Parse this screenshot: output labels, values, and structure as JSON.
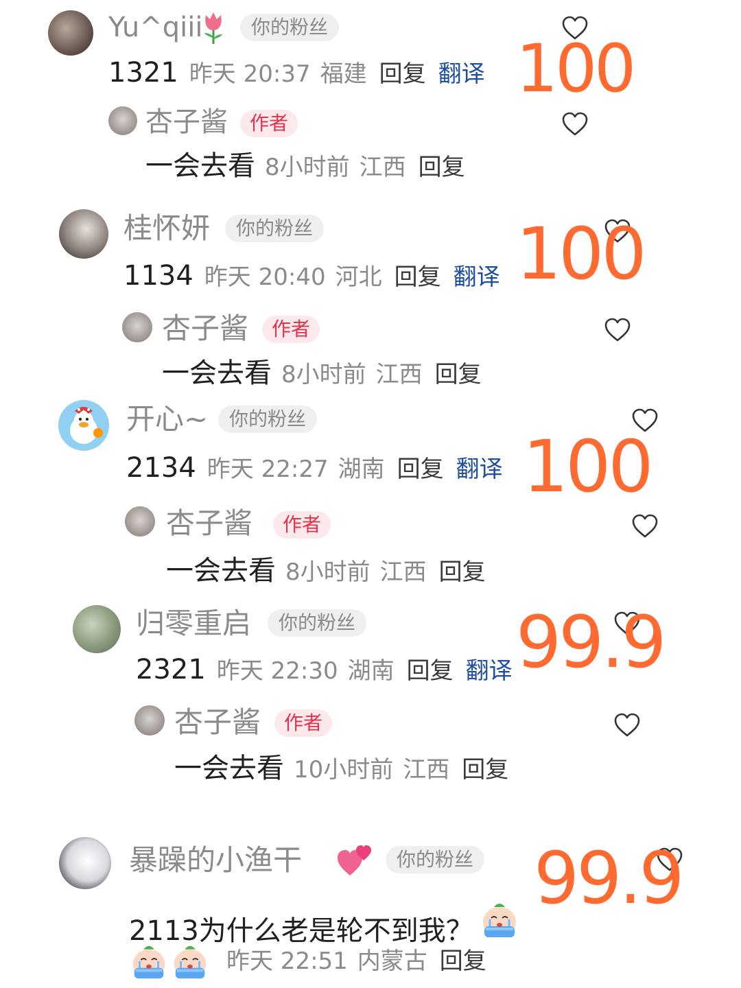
{
  "comments": [
    {
      "name": "Yu^qiii",
      "name_emoji": "tulip-icon",
      "badge": "你的粉丝",
      "content": "1321",
      "time": "昨天 20:37",
      "location": "福建",
      "reply": "回复",
      "translate": "翻译",
      "score": "100",
      "author_reply": {
        "name": "杏子酱",
        "badge": "作者",
        "content": "一会去看",
        "time": "8小时前",
        "location": "江西",
        "reply": "回复"
      }
    },
    {
      "name": "桂怀妍",
      "badge": "你的粉丝",
      "content": "1134",
      "time": "昨天 20:40",
      "location": "河北",
      "reply": "回复",
      "translate": "翻译",
      "score": "100",
      "author_reply": {
        "name": "杏子酱",
        "badge": "作者",
        "content": "一会去看",
        "time": "8小时前",
        "location": "江西",
        "reply": "回复"
      }
    },
    {
      "name": "开心~",
      "badge": "你的粉丝",
      "content": "2134",
      "time": "昨天 22:27",
      "location": "湖南",
      "reply": "回复",
      "translate": "翻译",
      "score": "100",
      "author_reply": {
        "name": "杏子酱",
        "badge": "作者",
        "content": "一会去看",
        "time": "8小时前",
        "location": "江西",
        "reply": "回复"
      }
    },
    {
      "name": "归零重启",
      "badge": "你的粉丝",
      "content": "2321",
      "time": "昨天 22:30",
      "location": "湖南",
      "reply": "回复",
      "translate": "翻译",
      "score": "99.9",
      "author_reply": {
        "name": "杏子酱",
        "badge": "作者",
        "content": "一会去看",
        "time": "10小时前",
        "location": "江西",
        "reply": "回复"
      }
    },
    {
      "name": "暴躁的小渔干",
      "name_emoji": "two-hearts-icon",
      "badge": "你的粉丝",
      "content": "2113为什么老是轮不到我？",
      "content_emoji": "crying-sticker-icon",
      "time": "昨天 22:51",
      "location": "内蒙古",
      "reply": "回复",
      "score": "99.9"
    }
  ],
  "colors": {
    "score": "#ff6a30",
    "author_badge_text": "#e3334b",
    "author_badge_bg": "#fde9ec",
    "translate": "#1d4ea0",
    "meta": "#8a8a8a"
  }
}
